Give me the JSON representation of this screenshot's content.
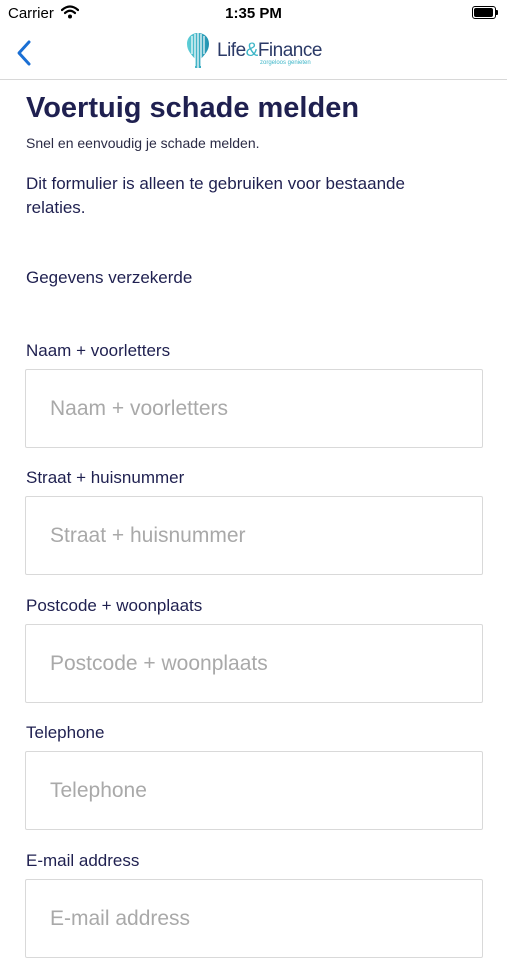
{
  "status_bar": {
    "carrier": "Carrier",
    "time": "1:35 PM"
  },
  "nav": {
    "back_icon": "chevron-left-icon",
    "logo_text_life": "Life",
    "logo_text_amp": "&",
    "logo_text_finance": "Finance",
    "logo_tagline": "zorgeloos genieten"
  },
  "header": {
    "title": "Voertuig schade melden",
    "subtitle": "Snel en eenvoudig je schade melden."
  },
  "notice": "Dit formulier is alleen te gebruiken voor bestaande relaties.",
  "section": {
    "heading": "Gegevens verzekerde"
  },
  "fields": [
    {
      "label": "Naam + voorletters",
      "placeholder": "Naam + voorletters",
      "value": ""
    },
    {
      "label": "Straat + huisnummer",
      "placeholder": "Straat + huisnummer",
      "value": ""
    },
    {
      "label": "Postcode + woonplaats",
      "placeholder": "Postcode + woonplaats",
      "value": ""
    },
    {
      "label": "Telephone",
      "placeholder": "Telephone",
      "value": ""
    },
    {
      "label": "E-mail address",
      "placeholder": "E-mail address",
      "value": ""
    }
  ],
  "colors": {
    "accent": "#1a6fd4",
    "title": "#1f2050",
    "logo_teal": "#3eb6c8",
    "input_border": "#d9d9d9"
  }
}
